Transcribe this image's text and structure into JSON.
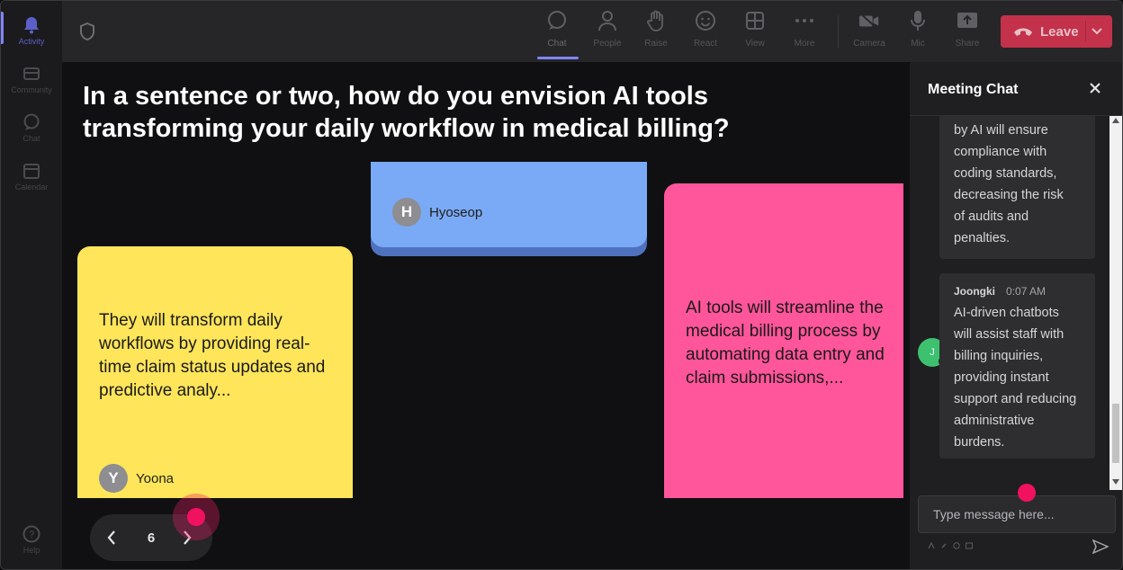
{
  "rail": {
    "items": [
      {
        "label": "Activity",
        "icon": "bell-icon"
      },
      {
        "label": "Community",
        "icon": "community-icon"
      },
      {
        "label": "Chat",
        "icon": "chat-icon"
      },
      {
        "label": "Calendar",
        "icon": "calendar-icon"
      },
      {
        "label": "Help",
        "icon": "help-icon"
      }
    ]
  },
  "toolbar": {
    "items": [
      {
        "label": "Chat",
        "icon": "chat-icon"
      },
      {
        "label": "People",
        "icon": "people-icon"
      },
      {
        "label": "Raise",
        "icon": "raise-hand-icon"
      },
      {
        "label": "React",
        "icon": "react-icon"
      },
      {
        "label": "View",
        "icon": "view-icon"
      },
      {
        "label": "More",
        "icon": "more-icon"
      },
      {
        "label": "Camera",
        "icon": "camera-off-icon"
      },
      {
        "label": "Mic",
        "icon": "mic-icon"
      },
      {
        "label": "Share",
        "icon": "share-icon"
      }
    ],
    "leave_label": "Leave",
    "leave_color": "#c4314b",
    "accent_color": "#7f85f5"
  },
  "board": {
    "question": "In a sentence or two, how do you envision AI tools transforming your daily workflow in medical billing?",
    "notes": [
      {
        "color": "#fee55a",
        "text": "They will transform daily workflows by providing real-time claim status updates and predictive analy...",
        "author": "Yoona",
        "initial": "Y"
      },
      {
        "color": "#7aaaf5",
        "text": "",
        "author": "Hyoseop",
        "initial": "H"
      },
      {
        "color": "#ff559a",
        "text": "AI tools will streamline the medical billing process by automating data entry and claim submissions,...",
        "author": "",
        "initial": ""
      }
    ],
    "page": "6"
  },
  "chat": {
    "title": "Meeting Chat",
    "messages": [
      {
        "sender": "",
        "time": "",
        "lines": [
          "by AI will ensure",
          "compliance with",
          "coding standards,",
          "decreasing the risk",
          "of audits and",
          "penalties."
        ]
      },
      {
        "sender": "Joongki",
        "initial": "J",
        "time": "0:07 AM",
        "avatar_color": "#3ec16f",
        "lines": [
          "AI-driven chatbots",
          "will assist staff with",
          "billing inquiries,",
          "providing instant",
          "support and reducing",
          "administrative",
          "burdens."
        ]
      }
    ],
    "input_placeholder": "Type message here..."
  }
}
